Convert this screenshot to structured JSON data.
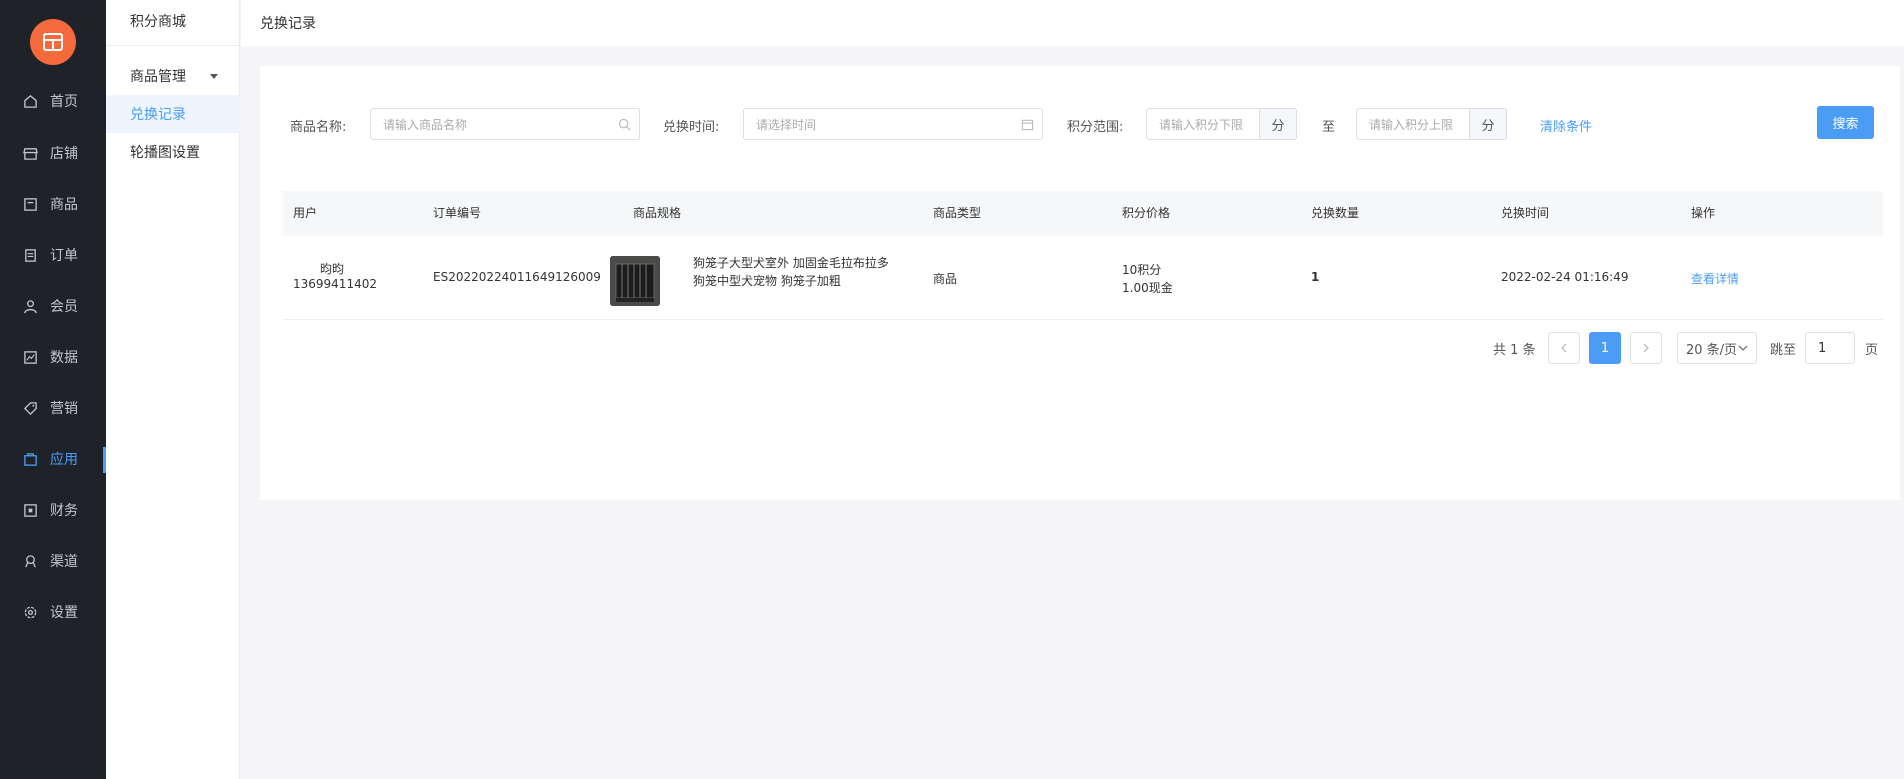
{
  "sidebar": {
    "items": [
      {
        "label": "首页",
        "icon": "home-icon"
      },
      {
        "label": "店铺",
        "icon": "store-icon"
      },
      {
        "label": "商品",
        "icon": "goods-icon"
      },
      {
        "label": "订单",
        "icon": "order-icon"
      },
      {
        "label": "会员",
        "icon": "user-icon"
      },
      {
        "label": "数据",
        "icon": "chart-icon"
      },
      {
        "label": "营销",
        "icon": "tag-icon"
      },
      {
        "label": "应用",
        "icon": "app-icon",
        "active": true
      },
      {
        "label": "财务",
        "icon": "finance-icon"
      },
      {
        "label": "渠道",
        "icon": "channel-icon"
      },
      {
        "label": "设置",
        "icon": "gear-icon"
      }
    ]
  },
  "subnav": {
    "title": "积分商城",
    "group": "商品管理",
    "items": [
      {
        "label": "兑换记录",
        "active": true
      },
      {
        "label": "轮播图设置"
      }
    ]
  },
  "header": {
    "title": "兑换记录"
  },
  "filters": {
    "name_label": "商品名称:",
    "name_placeholder": "请输入商品名称",
    "time_label": "兑换时间:",
    "time_placeholder": "请选择时间",
    "range_label": "积分范围:",
    "min_placeholder": "请输入积分下限",
    "max_placeholder": "请输入积分上限",
    "unit": "分",
    "to": "至",
    "clear": "清除条件",
    "search": "搜索"
  },
  "table": {
    "columns": [
      "用户",
      "订单编号",
      "商品规格",
      "商品类型",
      "积分价格",
      "兑换数量",
      "兑换时间",
      "操作"
    ],
    "rows": [
      {
        "user_name": "昀昀",
        "user_phone": "13699411402",
        "order_no": "ES2022022401164912600​9",
        "spec_line1": "狗笼子大型犬室外 加固金毛拉布拉多",
        "spec_line2": "狗笼中型犬宠物 狗笼子加粗",
        "type": "商品",
        "points": "10积分",
        "cash": "1.00现金",
        "qty": "1",
        "time": "2022-02-24 01:16:49",
        "action": "查看详情"
      }
    ]
  },
  "pagination": {
    "total": "共 1 条",
    "current": "1",
    "page_size": "20 条/页",
    "jump_label": "跳至",
    "jump_value": "1",
    "page_unit": "页"
  },
  "colors": {
    "accent": "#4b9cf5",
    "logo": "#f46a3c",
    "sidebar": "#1f2329"
  }
}
